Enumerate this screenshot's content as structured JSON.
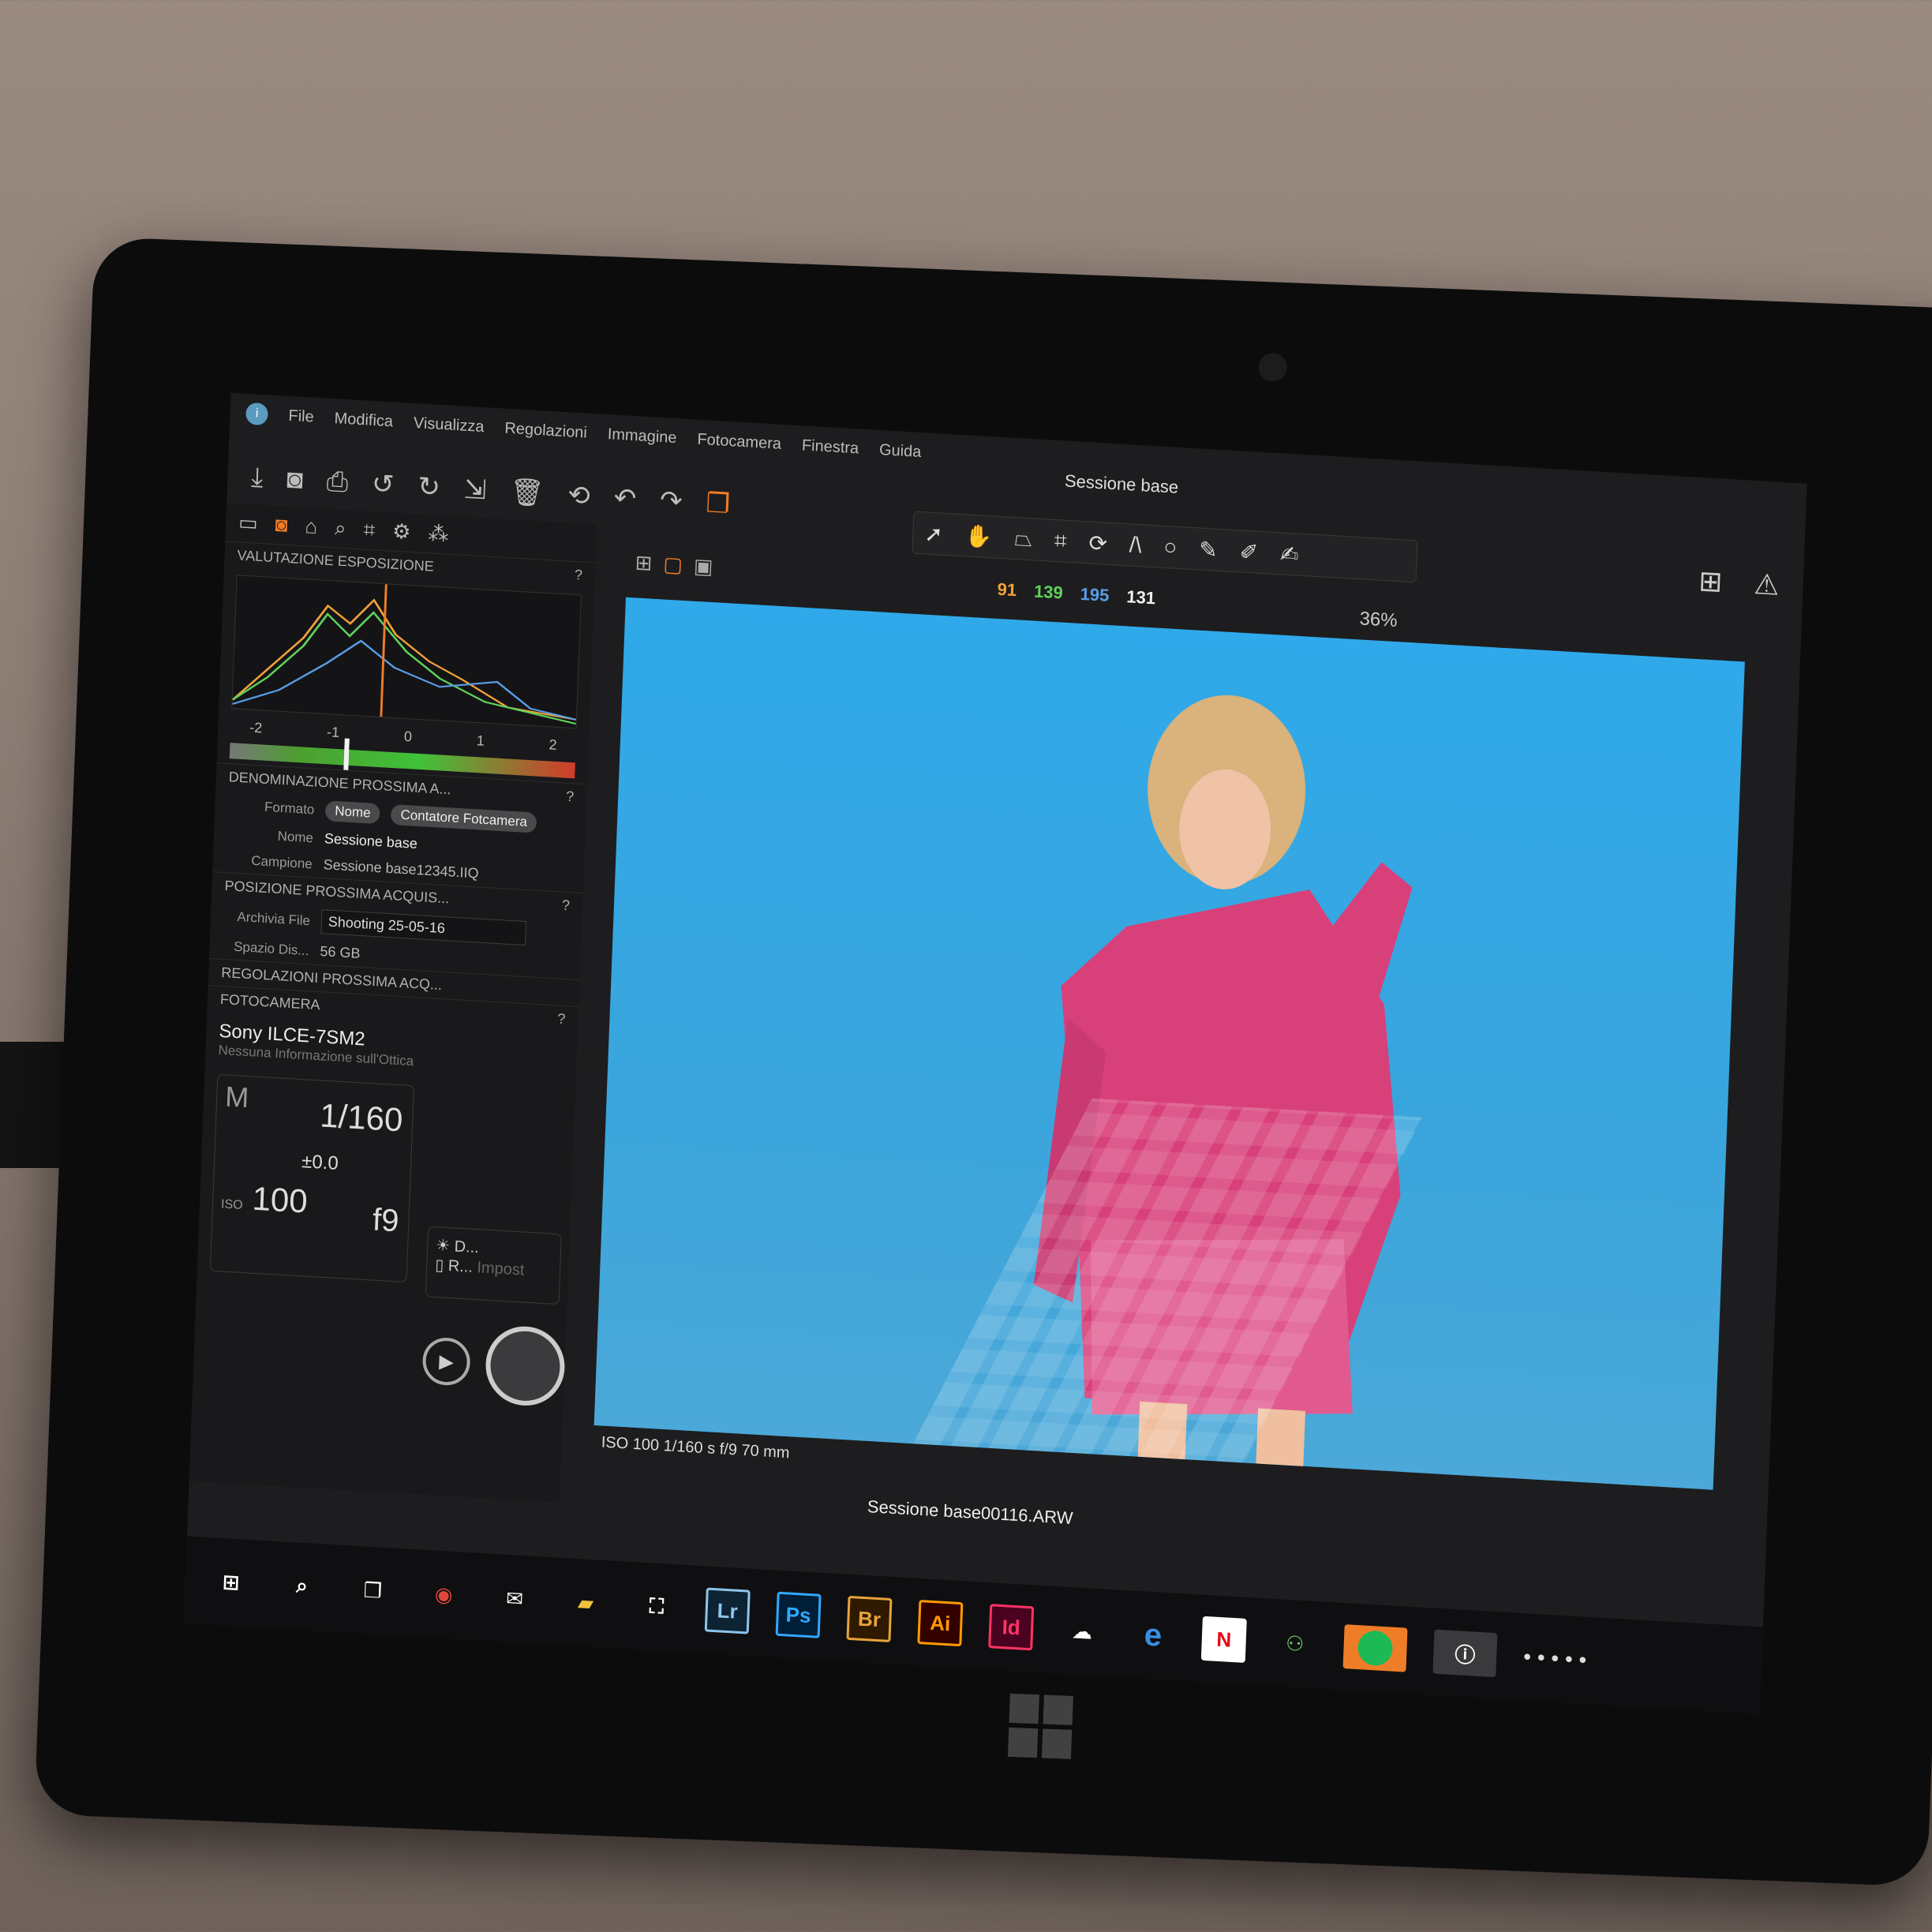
{
  "menu": {
    "items": [
      "File",
      "Modifica",
      "Visualizza",
      "Regolazioni",
      "Immagine",
      "Fotocamera",
      "Finestra",
      "Guida"
    ],
    "session_title": "Sessione base"
  },
  "exposure_panel": {
    "title": "VALUTAZIONE ESPOSIZIONE",
    "help": "?",
    "more": "...",
    "scale": [
      "-2",
      "-1",
      "0",
      "1",
      "2"
    ]
  },
  "naming_panel": {
    "title": "DENOMINAZIONE PROSSIMA A...",
    "format_label": "Formato",
    "format_tokens": [
      "Nome",
      "Contatore Fotcamera"
    ],
    "name_label": "Nome",
    "name_value": "Sessione base",
    "sample_label": "Campione",
    "sample_value": "Sessione base12345.IIQ"
  },
  "location_panel": {
    "title": "POSIZIONE PROSSIMA ACQUIS...",
    "archive_label": "Archivia File",
    "archive_value": "Shooting 25-05-16",
    "space_label": "Spazio Dis...",
    "space_value": "56 GB"
  },
  "adjust_panel": {
    "title": "REGOLAZIONI PROSSIMA ACQ..."
  },
  "camera_panel": {
    "title": "FOTOCAMERA",
    "model": "Sony ILCE-7SM2",
    "lens_info": "Nessuna Informazione sull'Ottica",
    "mode": "M",
    "shutter": "1/160",
    "ev": "±0.0",
    "iso_label": "ISO",
    "iso": "100",
    "aperture": "f9",
    "wb_label": "D...",
    "raw_label": "R...",
    "impost_label": "Impost"
  },
  "viewer": {
    "rgb": [
      "91",
      "139",
      "195",
      "131"
    ],
    "zoom": "36%",
    "meta": "ISO 100 1/160 s f/9 70 mm",
    "file_name": "Sessione base00116.ARW"
  },
  "taskbar": {
    "icons": [
      "Lr",
      "Ps",
      "Br",
      "Ai",
      "Id",
      "N"
    ],
    "tray": "• • • • •"
  },
  "colors": {
    "accent": "#ef7d28",
    "r": "#f1a23a",
    "g": "#5fd35b",
    "b": "#5a9de6",
    "l": "#f0f0f0"
  }
}
